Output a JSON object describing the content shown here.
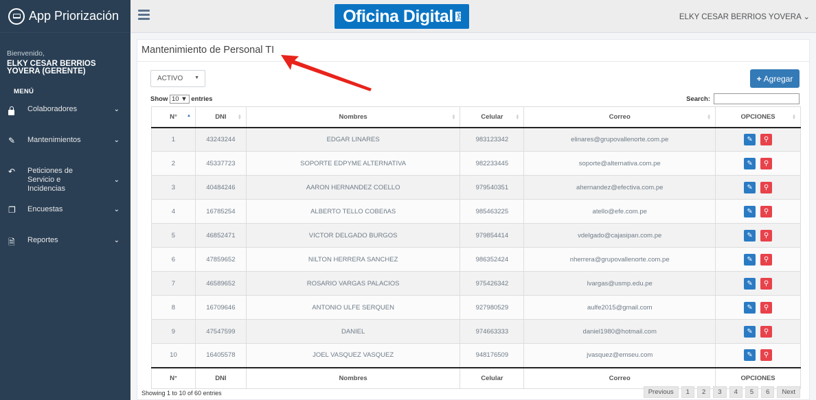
{
  "app": {
    "title": "App Priorización"
  },
  "sidebar": {
    "welcome": "Bienvenido,",
    "user_name": "ELKY CESAR BERRIOS YOVERA (GERENTE)",
    "menu_title": "MENÚ",
    "items": [
      {
        "label": "Colaboradores",
        "icon": "lock-icon"
      },
      {
        "label": "Mantenimientos",
        "icon": "edit-icon"
      },
      {
        "label": "Peticiones de Servicio e Incidencias",
        "icon": "reply-icon"
      },
      {
        "label": "Encuestas",
        "icon": "copy-icon"
      },
      {
        "label": "Reportes",
        "icon": "file-icon"
      }
    ]
  },
  "topbar": {
    "logo_text": "Oficina Digital",
    "logo_suffix": "SAC",
    "user_label": "ELKY CESAR BERRIOS YOVERA"
  },
  "panel": {
    "title": "Mantenimiento de Personal TI",
    "status_select": "ACTIVO",
    "add_button": "Agregar",
    "show_label_prefix": "Show",
    "show_value": "10",
    "show_label_suffix": "entries",
    "search_label": "Search:"
  },
  "table": {
    "columns": [
      "N°",
      "DNI",
      "Nombres",
      "Celular",
      "Correo",
      "OPCIONES"
    ],
    "rows": [
      [
        "1",
        "43243244",
        "EDGAR LINARES",
        "983123342",
        "elinares@grupovallenorte.com.pe"
      ],
      [
        "2",
        "45337723",
        "SOPORTE EDPYME ALTERNATIVA",
        "982233445",
        "soporte@alternativa.com.pe"
      ],
      [
        "3",
        "40484246",
        "AARON HERNANDEZ COELLO",
        "979540351",
        "ahernandez@efectiva.com.pe"
      ],
      [
        "4",
        "16785254",
        "ALBERTO TELLO COBEñAS",
        "985463225",
        "atello@efe.com.pe"
      ],
      [
        "5",
        "46852471",
        "VICTOR DELGADO BURGOS",
        "979854414",
        "vdelgado@cajasipan.com.pe"
      ],
      [
        "6",
        "47859652",
        "NILTON HERRERA SANCHEZ",
        "986352424",
        "nherrera@grupovallenorte.com.pe"
      ],
      [
        "7",
        "46589652",
        "ROSARIO VARGAS PALACIOS",
        "975426342",
        "lvargas@usmp.edu.pe"
      ],
      [
        "8",
        "16709646",
        "ANTONIO ULFE SERQUEN",
        "927980529",
        "aulfe2015@gmail.com"
      ],
      [
        "9",
        "47547599",
        "DANIEL",
        "974663333",
        "daniel1980@hotmail.com"
      ],
      [
        "10",
        "16405578",
        "JOEL VASQUEZ VASQUEZ",
        "948176509",
        "jvasquez@emseu.com"
      ]
    ]
  },
  "footer": {
    "info": "Showing 1 to 10 of 60 entries",
    "pages": [
      "Previous",
      "1",
      "2",
      "3",
      "4",
      "5",
      "6",
      "Next"
    ]
  },
  "colors": {
    "sidebar": "#2a3f54",
    "primary": "#337ab7",
    "danger": "#e8424b",
    "annotation_arrow": "#e8231b"
  }
}
